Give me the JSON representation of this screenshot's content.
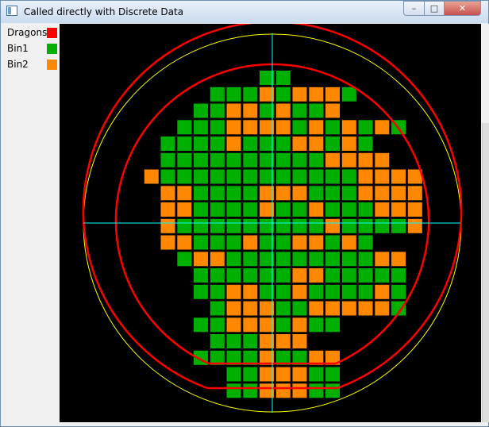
{
  "window": {
    "title": "Called directly with Discrete Data"
  },
  "legend": [
    {
      "label": "Dragons",
      "color": "#ff0000"
    },
    {
      "label": "Bin1",
      "color": "#00b000"
    },
    {
      "label": "Bin2",
      "color": "#ff8800"
    }
  ],
  "colors": {
    "background": "#000000",
    "edge": "#ff0000",
    "crosshair": "#00ffff",
    "flat_arc": "#ffff00"
  },
  "wafer": {
    "columns": 18,
    "rows": 20,
    "bins": [
      "........11........",
      ".....111212221....",
      "....112212112.....",
      "...11122221212121.",
      "..1111211122121...",
      "..11111111112222..",
      ".21111111111112222",
      "..2211112221112222",
      "..2211112112111222",
      "..2111111111211112",
      "..2211121122121...",
      "...12211111111122.",
      "....1111112211111.",
      "....1122112111121.",
      ".....122211222221.",
      "....112221211....",
      ".....111222.......",
      "....111121122.....",
      "......1122211.....",
      "......1122211....."
    ]
  }
}
